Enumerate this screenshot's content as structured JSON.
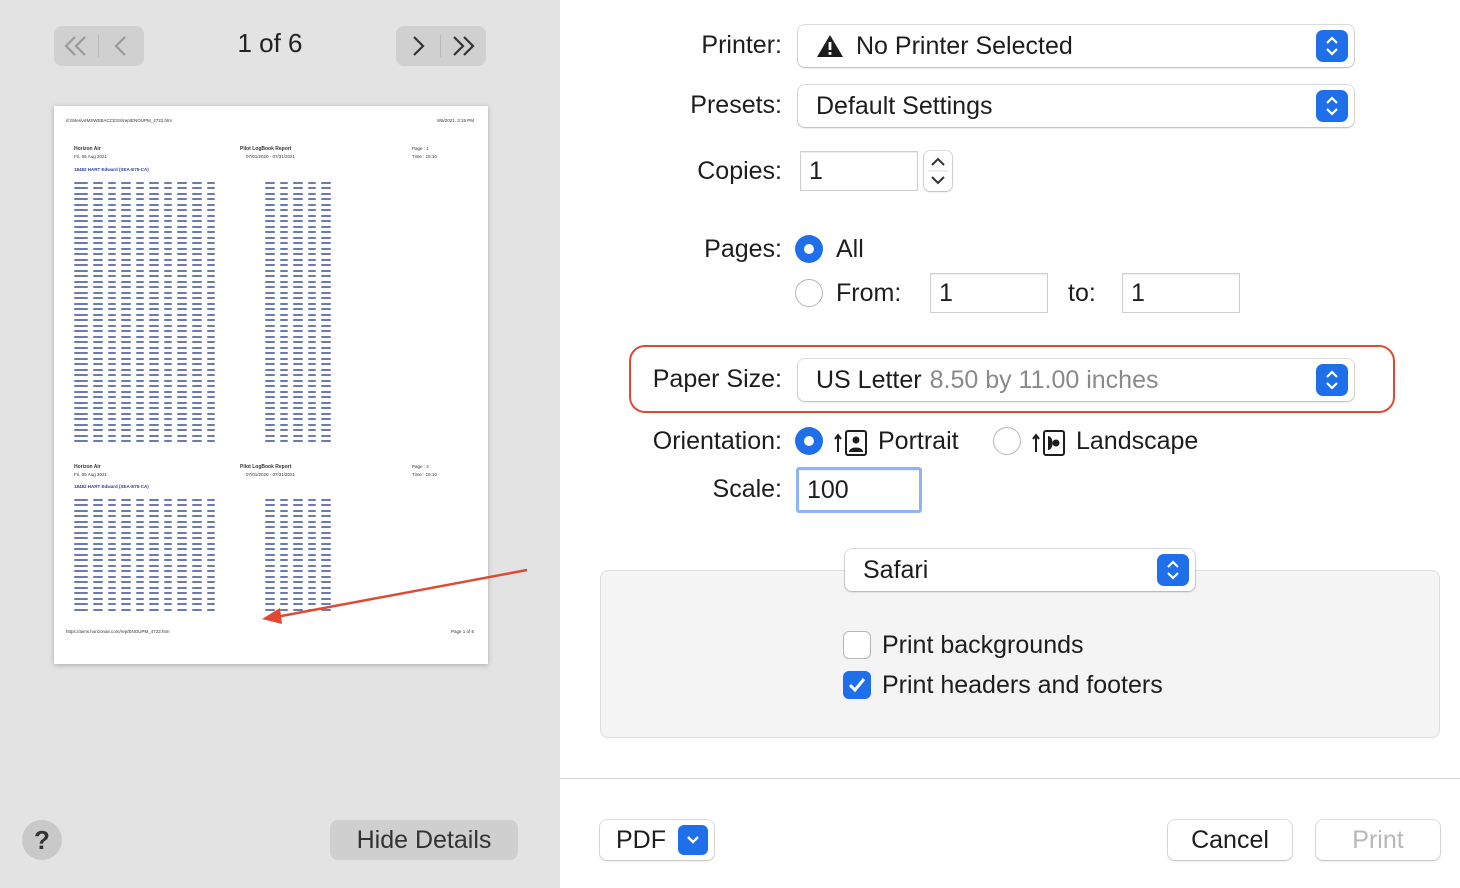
{
  "preview": {
    "page_indicator": "1 of 6",
    "hide_details_label": "Hide Details",
    "help_label": "?",
    "doc": {
      "path": "d:\\Sites\\AIMSWEBACCESS\\rep\\ENOUPM_4722.htm",
      "date": "8/6/2021, 3:15 PM",
      "company": "Horizon Air",
      "report_title": "Pilot LogBook Report",
      "report_range": "07/01/2020 - 07/31/2021",
      "page1": "Page : 1",
      "page2": "Page : 2",
      "time": "Time : 15:10",
      "print_date": "Fri, 06 Aug 2021",
      "crew": "18482 HART Edward (SEA-E75-CA)",
      "footer_url": "https://aims.horizonair.com/rep/ENOUPM_4722.htm",
      "footer_page": "Page 1 of 6"
    }
  },
  "settings": {
    "printer_label": "Printer:",
    "printer_value": "No Printer Selected",
    "presets_label": "Presets:",
    "presets_value": "Default Settings",
    "copies_label": "Copies:",
    "copies_value": "1",
    "pages_label": "Pages:",
    "pages_all": "All",
    "pages_from": "From:",
    "pages_from_value": "1",
    "pages_to": "to:",
    "pages_to_value": "1",
    "paper_size_label": "Paper Size:",
    "paper_size_value": "US Letter",
    "paper_size_detail": "8.50 by 11.00 inches",
    "orientation_label": "Orientation:",
    "portrait": "Portrait",
    "landscape": "Landscape",
    "scale_label": "Scale:",
    "scale_value": "100",
    "app_value": "Safari",
    "print_backgrounds": "Print backgrounds",
    "print_headers_footers": "Print headers and footers"
  },
  "footer": {
    "pdf_label": "PDF",
    "cancel_label": "Cancel",
    "print_label": "Print"
  },
  "colors": {
    "accent": "#1f6feb",
    "highlight": "#e04a33"
  }
}
